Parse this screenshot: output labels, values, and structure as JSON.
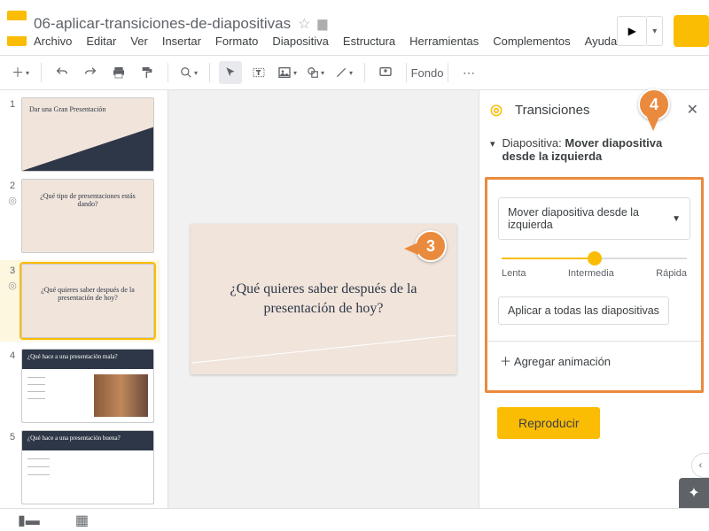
{
  "header": {
    "doc_title": "06-aplicar-transiciones-de-diapositivas",
    "menus": [
      "Archivo",
      "Editar",
      "Ver",
      "Insertar",
      "Formato",
      "Diapositiva",
      "Estructura",
      "Herramientas",
      "Complementos",
      "Ayuda"
    ]
  },
  "toolbar": {
    "fondo_label": "Fondo"
  },
  "thumbnails": [
    {
      "n": "1",
      "title": "Dar una Gran Presentación"
    },
    {
      "n": "2",
      "title": "¿Qué tipo de presentaciones estás dando?"
    },
    {
      "n": "3",
      "title": "¿Qué quieres saber después de la presentación de hoy?"
    },
    {
      "n": "4",
      "title": "¿Qué hace a una presentación mala?"
    },
    {
      "n": "5",
      "title": "¿Qué hace a una presentación buena?"
    }
  ],
  "canvas": {
    "slide_text": "¿Qué quieres saber después de la presentación de hoy?"
  },
  "panel": {
    "title": "Transiciones",
    "section_prefix": "Diapositiva:",
    "section_detail": "Mover diapositiva desde la izquierda",
    "select_label": "Mover diapositiva desde la izquierda",
    "speed_slow": "Lenta",
    "speed_mid": "Intermedia",
    "speed_fast": "Rápida",
    "apply_all": "Aplicar a todas las diapositivas",
    "add_animation": "Agregar animación",
    "play": "Reproducir"
  },
  "callouts": {
    "c3": "3",
    "c4": "4"
  }
}
